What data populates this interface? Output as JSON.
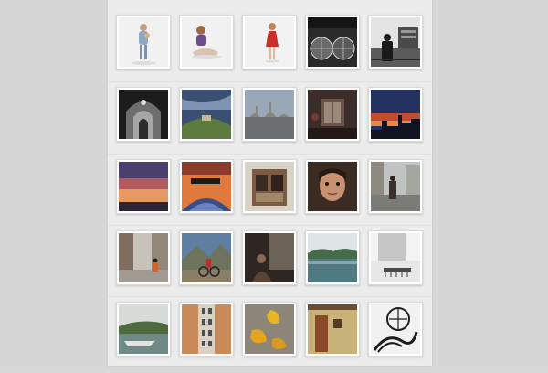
{
  "gallery": {
    "title": "",
    "rows": [
      {
        "items": [
          {
            "subject": "child-portrait",
            "tone": "white-background"
          },
          {
            "subject": "child-sitting",
            "tone": "white-background"
          },
          {
            "subject": "child-red-dress",
            "tone": "white-background"
          },
          {
            "subject": "glass-domes",
            "tone": "black-and-white"
          },
          {
            "subject": "man-ferry",
            "tone": "black-and-white"
          }
        ]
      },
      {
        "items": [
          {
            "subject": "mosque-interior",
            "tone": "black-and-white"
          },
          {
            "subject": "hill-under-sky",
            "tone": "color"
          },
          {
            "subject": "city-skyline",
            "tone": "color"
          },
          {
            "subject": "dark-interior-window",
            "tone": "color"
          },
          {
            "subject": "sunset-skyline",
            "tone": "color"
          }
        ]
      },
      {
        "items": [
          {
            "subject": "sunset-clouds",
            "tone": "color"
          },
          {
            "subject": "boat-bow-sunset",
            "tone": "color"
          },
          {
            "subject": "window-shutters",
            "tone": "color"
          },
          {
            "subject": "child-face",
            "tone": "color"
          },
          {
            "subject": "man-street",
            "tone": "color"
          }
        ]
      },
      {
        "items": [
          {
            "subject": "street-scene",
            "tone": "color"
          },
          {
            "subject": "cyclist-mountain",
            "tone": "color"
          },
          {
            "subject": "figure-in-shadow",
            "tone": "color"
          },
          {
            "subject": "lake-reflection",
            "tone": "color"
          },
          {
            "subject": "pier-in-fog",
            "tone": "black-and-white"
          }
        ]
      },
      {
        "items": [
          {
            "subject": "river-boat",
            "tone": "color"
          },
          {
            "subject": "building-facade",
            "tone": "color"
          },
          {
            "subject": "autumn-leaves",
            "tone": "color"
          },
          {
            "subject": "wooden-door",
            "tone": "color"
          },
          {
            "subject": "spiral-structure",
            "tone": "black-and-white"
          }
        ]
      }
    ]
  },
  "colors": {
    "page_background": "#d6d6d6",
    "column_background": "#ececec",
    "frame": "#ffffff"
  }
}
